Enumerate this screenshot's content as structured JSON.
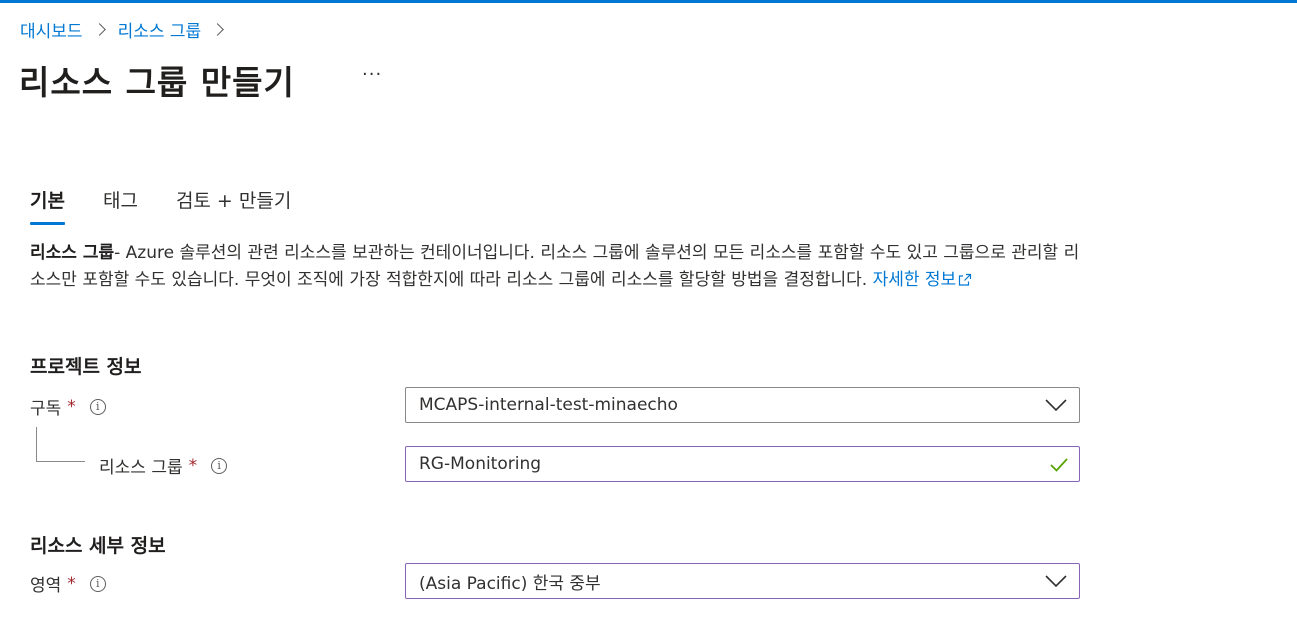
{
  "breadcrumb": {
    "items": [
      "대시보드",
      "리소스 그룹"
    ]
  },
  "page": {
    "title": "리소스 그룹 만들기",
    "more_label": "···"
  },
  "tabs": [
    {
      "label": "기본",
      "active": true
    },
    {
      "label": "태그",
      "active": false
    },
    {
      "label": "검토 + 만들기",
      "active": false
    }
  ],
  "description": {
    "bold": "리소스 그룹",
    "text": "- Azure 솔루션의 관련 리소스를 보관하는 컨테이너입니다. 리소스 그룹에 솔루션의 모든 리소스를 포함할 수도 있고 그룹으로 관리할 리소스만 포함할 수도 있습니다. 무엇이 조직에 가장 적합한지에 따라 리소스 그룹에 리소스를 할당할 방법을 결정합니다.",
    "link": "자세한 정보"
  },
  "project": {
    "section_title": "프로젝트 정보",
    "subscription_label": "구독",
    "subscription_value": "MCAPS-internal-test-minaecho",
    "resource_group_label": "리소스 그룹",
    "resource_group_value": "RG-Monitoring",
    "required_mark": "*"
  },
  "details": {
    "section_title": "리소스 세부 정보",
    "region_label": "영역",
    "region_value": "(Asia Pacific) 한국 중부"
  },
  "colors": {
    "accent": "#0078d4",
    "required": "#a4262c",
    "valid": "#57a300",
    "focus_border": "#8764b8"
  }
}
